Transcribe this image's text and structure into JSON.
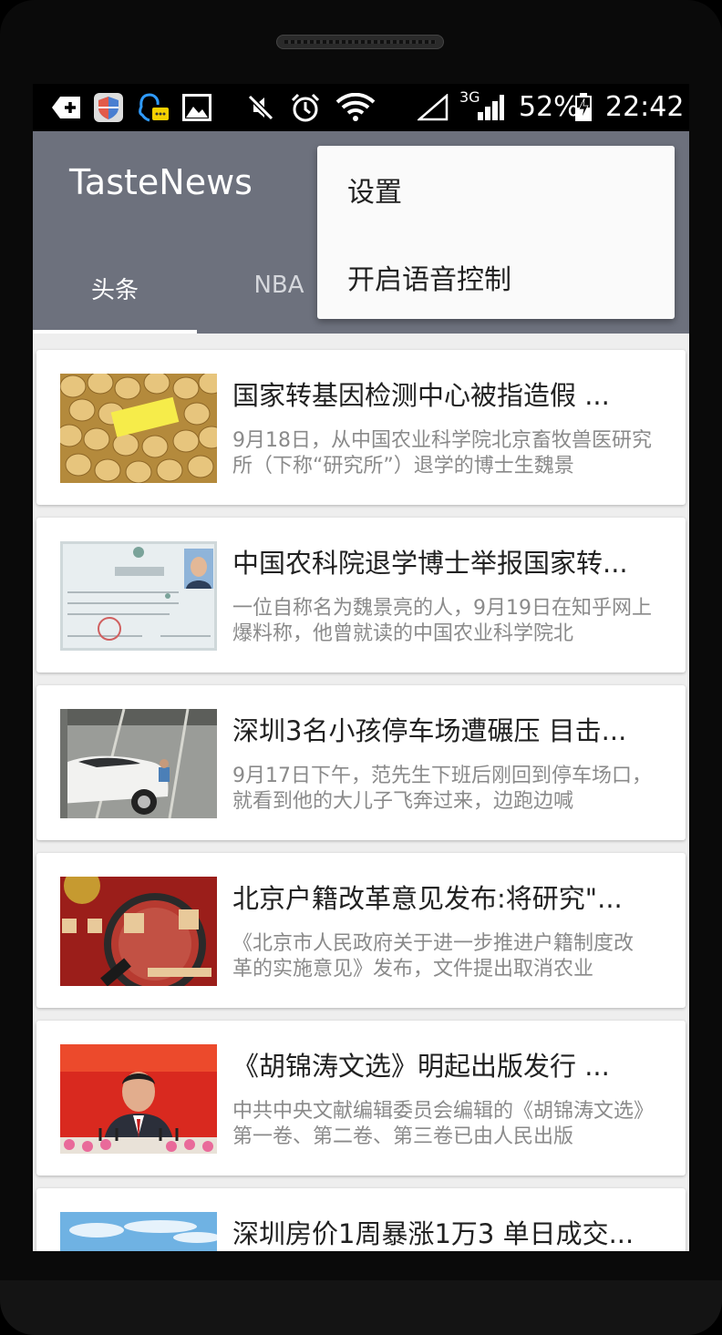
{
  "status_bar": {
    "icons": [
      "add-notification-icon",
      "shield-app-icon",
      "qq-chat-icon",
      "picture-icon",
      "mute-icon",
      "alarm-icon",
      "wifi-icon",
      "signal-empty-icon",
      "signal-3g-icon",
      "battery-charging-icon"
    ],
    "network_type": "3G",
    "battery": "52%",
    "time": "22:42"
  },
  "app": {
    "title": "TasteNews",
    "tabs": [
      {
        "label": "头条",
        "active": true
      },
      {
        "label": "NBA",
        "active": false
      }
    ]
  },
  "overflow_menu": {
    "items": [
      {
        "label": "设置"
      },
      {
        "label": "开启语音控制"
      }
    ]
  },
  "news": [
    {
      "title": "国家转基因检测中心被指造假 ...",
      "desc": "9月18日，从中国农业科学院北京畜牧兽医研究所（下称“研究所”）退学的博士生魏景",
      "thumb": "soybeans-image"
    },
    {
      "title": "中国农科院退学博士举报国家转...",
      "desc": "一位自称名为魏景亮的人，9月19日在知乎网上爆料称，他曾就读的中国农业科学院北",
      "thumb": "certificate-image"
    },
    {
      "title": "深圳3名小孩停车场遭碾压 目击...",
      "desc": "9月17日下午，范先生下班后刚回到停车场口，就看到他的大儿子飞奔过来，边跑边喊",
      "thumb": "parking-car-image"
    },
    {
      "title": "北京户籍改革意见发布:将研究\"...",
      "desc": "《北京市人民政府关于进一步推进户籍制度改革的实施意见》发布，文件提出取消农业",
      "thumb": "household-register-image"
    },
    {
      "title": "《胡锦涛文选》明起出版发行 ...",
      "desc": "中共中央文献编辑委员会编辑的《胡锦涛文选》第一卷、第二卷、第三卷已由人民出版",
      "thumb": "speaker-podium-image"
    },
    {
      "title": "深圳房价1周暴涨1万3 单日成交...",
      "desc": "",
      "thumb": "city-sky-image"
    }
  ]
}
